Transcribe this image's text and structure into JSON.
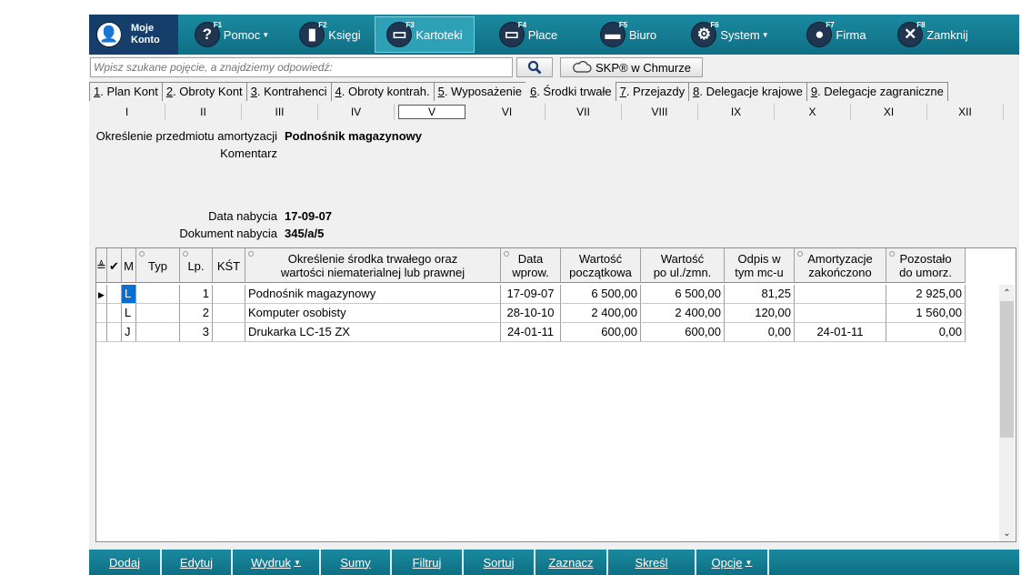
{
  "toolbar": {
    "moje_konto": "Moje\nKonto",
    "moje_konto_line1": "Moje",
    "moje_konto_line2": "Konto",
    "items": [
      {
        "fkey": "F1",
        "label": "Pomoc",
        "icon": "question-icon",
        "dropdown": true
      },
      {
        "fkey": "F2",
        "label": "Księgi",
        "icon": "book-icon",
        "dropdown": false
      },
      {
        "fkey": "F3",
        "label": "Kartoteki",
        "icon": "folder-icon",
        "dropdown": false
      },
      {
        "fkey": "F4",
        "label": "Płace",
        "icon": "money-icon",
        "dropdown": false
      },
      {
        "fkey": "F5",
        "label": "Biuro",
        "icon": "briefcase-icon",
        "dropdown": false
      },
      {
        "fkey": "F6",
        "label": "System",
        "icon": "gears-icon",
        "dropdown": true
      },
      {
        "fkey": "F7",
        "label": "Firma",
        "icon": "person-icon",
        "dropdown": false
      },
      {
        "fkey": "F8",
        "label": "Zamknij",
        "icon": "close-icon",
        "dropdown": false
      }
    ]
  },
  "search": {
    "placeholder": "Wpisz szukane pojęcie, a znajdziemy odpowiedź:",
    "skp_label": "SKP® w Chmurze"
  },
  "tabs": [
    {
      "key": "1",
      "label": ". Plan Kont"
    },
    {
      "key": "2",
      "label": ". Obroty Kont"
    },
    {
      "key": "3",
      "label": ". Kontrahenci"
    },
    {
      "key": "4",
      "label": ". Obroty kontrah."
    },
    {
      "key": "5",
      "label": ". Wyposażenie"
    },
    {
      "key": "6",
      "label": ". Środki trwałe"
    },
    {
      "key": "7",
      "label": ". Przejazdy"
    },
    {
      "key": "8",
      "label": ". Delegacje krajowe"
    },
    {
      "key": "9",
      "label": ". Delegacje zagraniczne"
    }
  ],
  "active_tab": 5,
  "months": [
    "I",
    "II",
    "III",
    "IV",
    "V",
    "VI",
    "VII",
    "VIII",
    "IX",
    "X",
    "XI",
    "XII"
  ],
  "active_month": 4,
  "info": {
    "przedmiot_label": "Określenie przedmiotu amortyzacji",
    "przedmiot_value": "Podnośnik magazynowy",
    "komentarz_label": "Komentarz",
    "data_nabycia_label": "Data nabycia",
    "data_nabycia_value": "17-09-07",
    "dokument_label": "Dokument nabycia",
    "dokument_value": "345/a/5"
  },
  "table": {
    "headers": {
      "sort": "≜",
      "check": "✔",
      "m": "M",
      "typ": "Typ",
      "lp": "Lp.",
      "kst": "KŚT",
      "okreslenie": "Określenie środka trwałego oraz wartości niematerialnej lub prawnej",
      "data": "Data wprow.",
      "wart_pocz": "Wartość początkowa",
      "wart_ul": "Wartość po ul./zmn.",
      "odpis": "Odpis w tym mc-u",
      "amort": "Amortyzacje zakończono",
      "pozostalo": "Pozostało do umorz."
    },
    "header_lines": {
      "okreslenie": [
        "Określenie środka trwałego oraz",
        "wartości niematerialnej lub prawnej"
      ],
      "data": [
        "Data",
        "wprow."
      ],
      "wart_pocz": [
        "Wartość",
        "początkowa"
      ],
      "wart_ul": [
        "Wartość",
        "po ul./zmn."
      ],
      "odpis": [
        "Odpis w",
        "tym mc-u"
      ],
      "amort": [
        "Amortyzacje",
        "zakończono"
      ],
      "pozostalo": [
        "Pozostało",
        "do umorz."
      ]
    },
    "rows": [
      {
        "m": "L",
        "typ": "",
        "lp": "1",
        "kst": "",
        "okreslenie": "Podnośnik magazynowy",
        "data": "17-09-07",
        "wart_pocz": "6 500,00",
        "wart_ul": "6 500,00",
        "odpis": "81,25",
        "amort": "",
        "pozostalo": "2 925,00"
      },
      {
        "m": "L",
        "typ": "",
        "lp": "2",
        "kst": "",
        "okreslenie": "Komputer osobisty",
        "data": "28-10-10",
        "wart_pocz": "2 400,00",
        "wart_ul": "2 400,00",
        "odpis": "120,00",
        "amort": "",
        "pozostalo": "1 560,00"
      },
      {
        "m": "J",
        "typ": "",
        "lp": "3",
        "kst": "",
        "okreslenie": "Drukarka LC-15 ZX",
        "data": "24-01-11",
        "wart_pocz": "600,00",
        "wart_ul": "600,00",
        "odpis": "0,00",
        "amort": "24-01-11",
        "pozostalo": "0,00"
      }
    ]
  },
  "bottom": [
    {
      "label": "Dodaj",
      "dropdown": false
    },
    {
      "label": "Edytuj",
      "dropdown": false
    },
    {
      "label": "Wydruk",
      "dropdown": true
    },
    {
      "label": "Sumy",
      "dropdown": false
    },
    {
      "label": "Filtruj",
      "dropdown": false
    },
    {
      "label": "Sortuj",
      "dropdown": false
    },
    {
      "label": "Zaznacz",
      "dropdown": false
    },
    {
      "label": "Skreśl",
      "dropdown": false
    },
    {
      "label": "Opcje",
      "dropdown": true
    }
  ],
  "colors": {
    "toolbar": "#1a8aa0",
    "selection": "#0a6ed1",
    "moje_konto_bg": "#153e6a"
  }
}
